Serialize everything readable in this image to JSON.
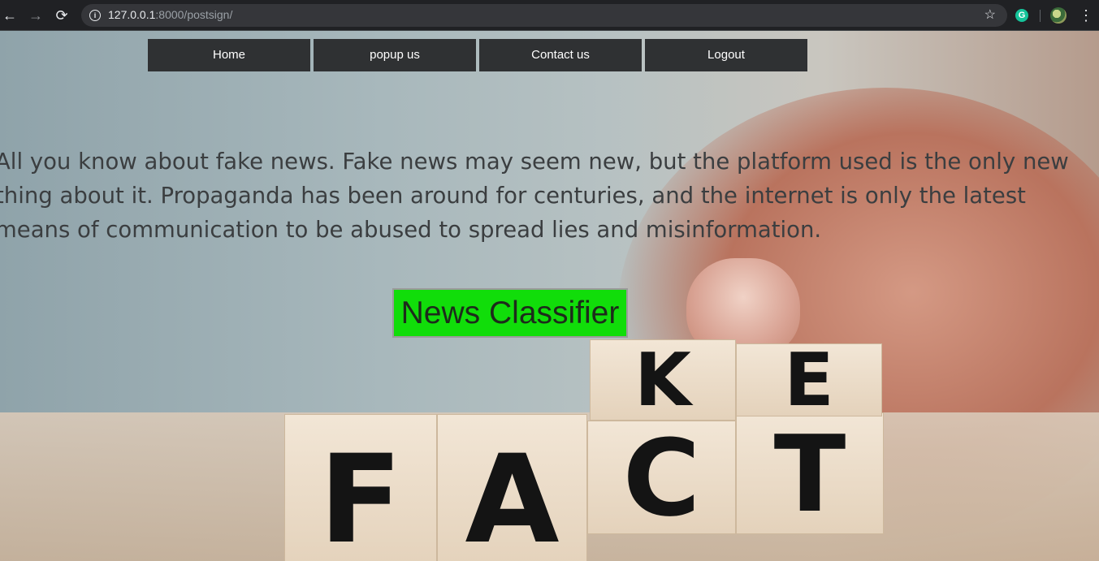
{
  "browser": {
    "back_icon": "←",
    "forward_icon": "→",
    "reload_icon": "⟳",
    "url_host": "127.0.0.1",
    "url_rest": ":8000/postsign/",
    "star_icon": "☆",
    "extension_letter": "G",
    "menu_icon": "⋮"
  },
  "nav": {
    "items": [
      {
        "label": "Home"
      },
      {
        "label": "popup us"
      },
      {
        "label": "Contact us"
      },
      {
        "label": "Logout"
      }
    ]
  },
  "main": {
    "intro_text": "All you know about fake news. Fake news may seem new, but the platform used is the only new thing about it. Propaganda has been around for centuries, and the internet is only the latest means of communication to be abused to spread lies and misinformation.",
    "classifier_button": "News Classifier"
  },
  "background": {
    "blocks_bottom": [
      "F",
      "A",
      "C",
      "T"
    ],
    "blocks_top": [
      "K",
      "E"
    ]
  },
  "colors": {
    "classifier_bg": "#11dd0a",
    "nav_bg": "#2f3133",
    "chrome_bg": "#202124"
  }
}
